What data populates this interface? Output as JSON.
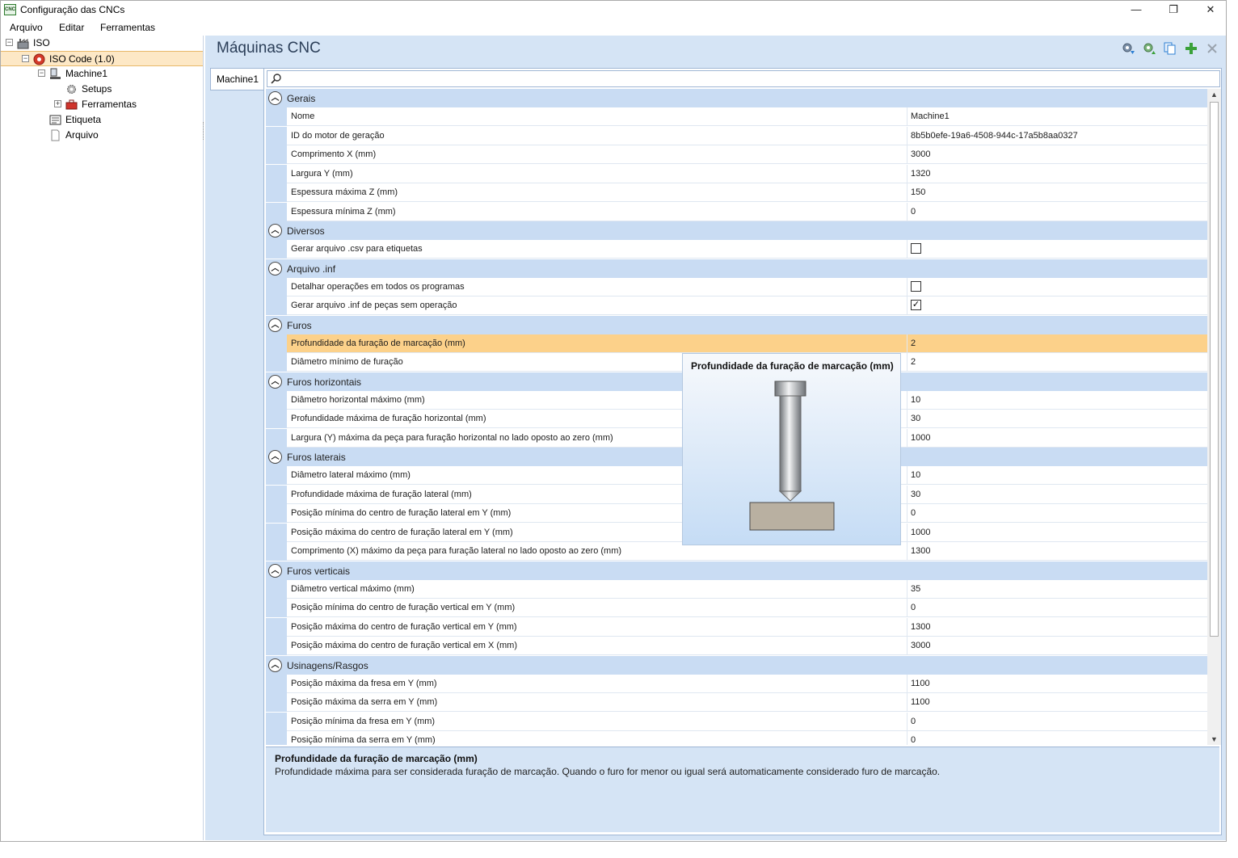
{
  "window": {
    "title": "Configuração das CNCs",
    "app_icon_text": "CNC",
    "minimize": "—",
    "restore": "❐",
    "close": "✕"
  },
  "menu": [
    "Arquivo",
    "Editar",
    "Ferramentas"
  ],
  "tree": [
    {
      "label": "ISO",
      "level": 0,
      "expander": "−",
      "icon": "factory-icon"
    },
    {
      "label": "ISO Code (1.0)",
      "level": 1,
      "expander": "−",
      "icon": "iso-code-icon",
      "selected": true
    },
    {
      "label": "Machine1",
      "level": 2,
      "expander": "−",
      "icon": "machine-icon"
    },
    {
      "label": "Setups",
      "level": 3,
      "expander": "",
      "icon": "gear-icon"
    },
    {
      "label": "Ferramentas",
      "level": 3,
      "expander": "+",
      "icon": "toolbox-icon"
    },
    {
      "label": "Etiqueta",
      "level": 2,
      "expander": "",
      "icon": "label-icon"
    },
    {
      "label": "Arquivo",
      "level": 2,
      "expander": "",
      "icon": "file-icon"
    }
  ],
  "main": {
    "title": "Máquinas CNC",
    "tab": "Machine1"
  },
  "grid": [
    {
      "category": "Gerais",
      "rows": [
        {
          "name": "Nome",
          "value": "Machine1"
        },
        {
          "name": "ID do motor de geração",
          "value": "8b5b0efe-19a6-4508-944c-17a5b8aa0327"
        },
        {
          "name": "Comprimento X (mm)",
          "value": "3000"
        },
        {
          "name": "Largura Y (mm)",
          "value": "1320"
        },
        {
          "name": "Espessura máxima Z (mm)",
          "value": "150"
        },
        {
          "name": "Espessura mínima Z (mm)",
          "value": "0"
        }
      ]
    },
    {
      "category": "Diversos",
      "rows": [
        {
          "name": "Gerar arquivo .csv para etiquetas",
          "checkbox": false
        }
      ]
    },
    {
      "category": "Arquivo .inf",
      "rows": [
        {
          "name": "Detalhar operações em todos os programas",
          "checkbox": false
        },
        {
          "name": "Gerar arquivo .inf de peças sem operação",
          "checkbox": true
        }
      ]
    },
    {
      "category": "Furos",
      "rows": [
        {
          "name": "Profundidade da furação de marcação (mm)",
          "value": "2",
          "selected": true
        },
        {
          "name": "Diâmetro mínimo de furação",
          "value": "2"
        }
      ]
    },
    {
      "category": "Furos horizontais",
      "rows": [
        {
          "name": "Diâmetro horizontal máximo (mm)",
          "value": "10"
        },
        {
          "name": "Profundidade máxima de furação horizontal (mm)",
          "value": "30"
        },
        {
          "name": "Largura (Y) máxima da peça para furação horizontal no lado oposto ao zero (mm)",
          "value": "1000"
        }
      ]
    },
    {
      "category": "Furos laterais",
      "rows": [
        {
          "name": "Diâmetro lateral máximo (mm)",
          "value": "10"
        },
        {
          "name": "Profundidade máxima de furação lateral (mm)",
          "value": "30"
        },
        {
          "name": "Posição mínima do centro de furação lateral em Y (mm)",
          "value": "0"
        },
        {
          "name": "Posição máxima do centro de furação lateral em Y (mm)",
          "value": "1000"
        },
        {
          "name": "Comprimento (X) máximo da peça para furação lateral no lado oposto ao zero (mm)",
          "value": "1300"
        }
      ]
    },
    {
      "category": "Furos verticais",
      "rows": [
        {
          "name": "Diâmetro vertical máximo (mm)",
          "value": "35"
        },
        {
          "name": "Posição mínima do centro de furação vertical em Y (mm)",
          "value": "0"
        },
        {
          "name": "Posição máxima do centro de furação vertical em Y (mm)",
          "value": "1300"
        },
        {
          "name": "Posição máxima do centro de furação vertical em X (mm)",
          "value": "3000"
        }
      ]
    },
    {
      "category": "Usinagens/Rasgos",
      "rows": [
        {
          "name": "Posição máxima da fresa em Y (mm)",
          "value": "1100"
        },
        {
          "name": "Posição máxima da serra em Y (mm)",
          "value": "1100"
        },
        {
          "name": "Posição mínima da fresa em Y (mm)",
          "value": "0"
        },
        {
          "name": "Posição mínima da serra em Y (mm)",
          "value": "0"
        }
      ]
    }
  ],
  "tooltip": {
    "title": "Profundidade da furação de marcação (mm)"
  },
  "description": {
    "title": "Profundidade da furação de marcação (mm)",
    "text": "Profundidade máxima para ser considerada furação de marcação. Quando o furo for menor ou igual será automaticamente considerado furo de marcação."
  },
  "colors": {
    "selected_row": "#fcd18a",
    "category_band": "#c9dcf3",
    "panel_background": "#d5e4f5",
    "add_button": "#3aa13a",
    "delete_button": "#9aa3ad"
  }
}
